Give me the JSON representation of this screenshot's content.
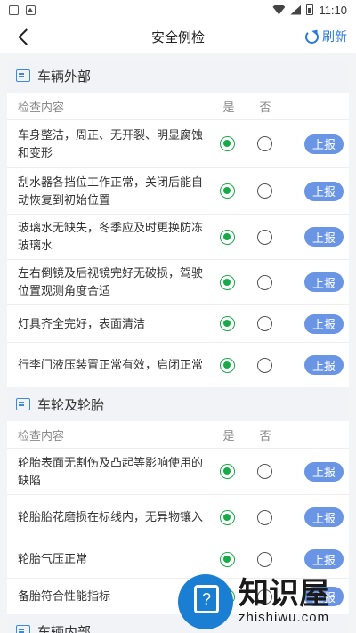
{
  "status": {
    "time": "11:10"
  },
  "nav": {
    "title": "安全例检",
    "refresh": "刷新"
  },
  "col_headers": {
    "content": "检查内容",
    "yes": "是",
    "no": "否"
  },
  "report_label": "上报",
  "sections": [
    {
      "title": "车辆外部",
      "items": [
        {
          "text": "车身整洁，周正、无开裂、明显腐蚀和变形",
          "answer": "yes"
        },
        {
          "text": "刮水器各挡位工作正常，关闭后能自动恢复到初始位置",
          "answer": "yes"
        },
        {
          "text": "玻璃水无缺失，冬季应及时更换防冻玻璃水",
          "answer": "yes"
        },
        {
          "text": "左右倒镜及后视镜完好无破损，驾驶位置观测角度合适",
          "answer": "yes"
        },
        {
          "text": "灯具齐全完好，表面清洁",
          "answer": "yes"
        },
        {
          "text": "行李门液压装置正常有效，启闭正常",
          "answer": "yes"
        }
      ]
    },
    {
      "title": "车轮及轮胎",
      "items": [
        {
          "text": "轮胎表面无割伤及凸起等影响使用的缺陷",
          "answer": "yes"
        },
        {
          "text": "轮胎胎花磨损在标线内，无异物镶入",
          "answer": "yes"
        },
        {
          "text": "轮胎气压正常",
          "answer": "yes"
        },
        {
          "text": "备胎符合性能指标",
          "answer": "yes"
        }
      ]
    },
    {
      "title": "车辆内部",
      "items": []
    }
  ],
  "watermark": {
    "cn": "知识屋",
    "en": "zhishiwu.com"
  }
}
